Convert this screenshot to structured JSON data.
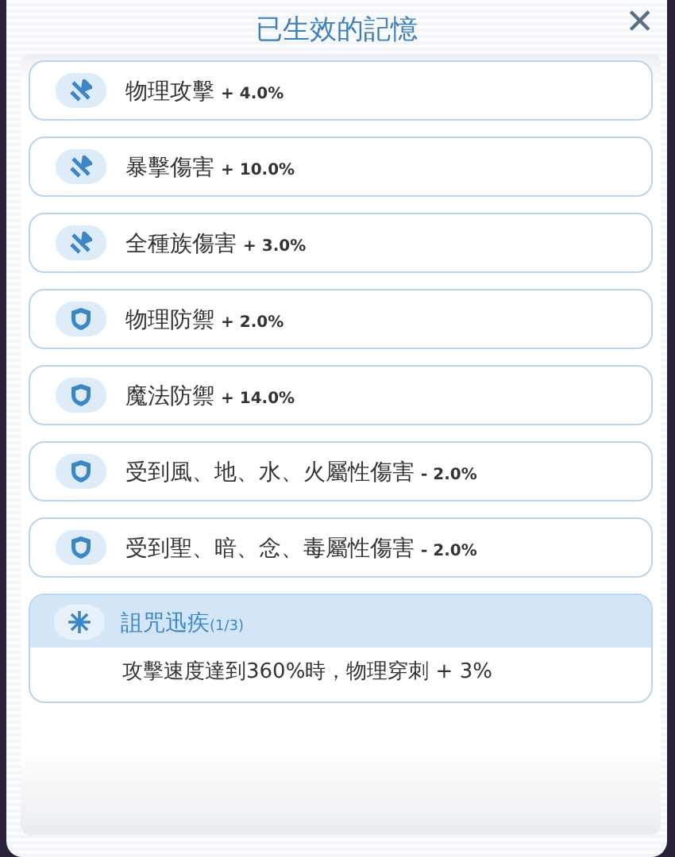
{
  "dialog": {
    "title": "已生效的記憶",
    "close_label": "✕"
  },
  "effects": [
    {
      "kind": "attack",
      "name": "物理攻擊",
      "value": "+ 4.0%"
    },
    {
      "kind": "attack",
      "name": "暴擊傷害",
      "value": "+ 10.0%"
    },
    {
      "kind": "attack",
      "name": "全種族傷害",
      "value": "+ 3.0%"
    },
    {
      "kind": "defense",
      "name": "物理防禦",
      "value": "+ 2.0%"
    },
    {
      "kind": "defense",
      "name": "魔法防禦",
      "value": "+ 14.0%"
    },
    {
      "kind": "defense",
      "name": "受到風、地、水、火屬性傷害",
      "value": "- 2.0%"
    },
    {
      "kind": "defense",
      "name": "受到聖、暗、念、毒屬性傷害",
      "value": "- 2.0%"
    }
  ],
  "set_bonus": {
    "title": "詛咒迅疾",
    "count": "(1/3)",
    "description": "攻擊速度達到360%時，物理穿刺 + 3%"
  }
}
